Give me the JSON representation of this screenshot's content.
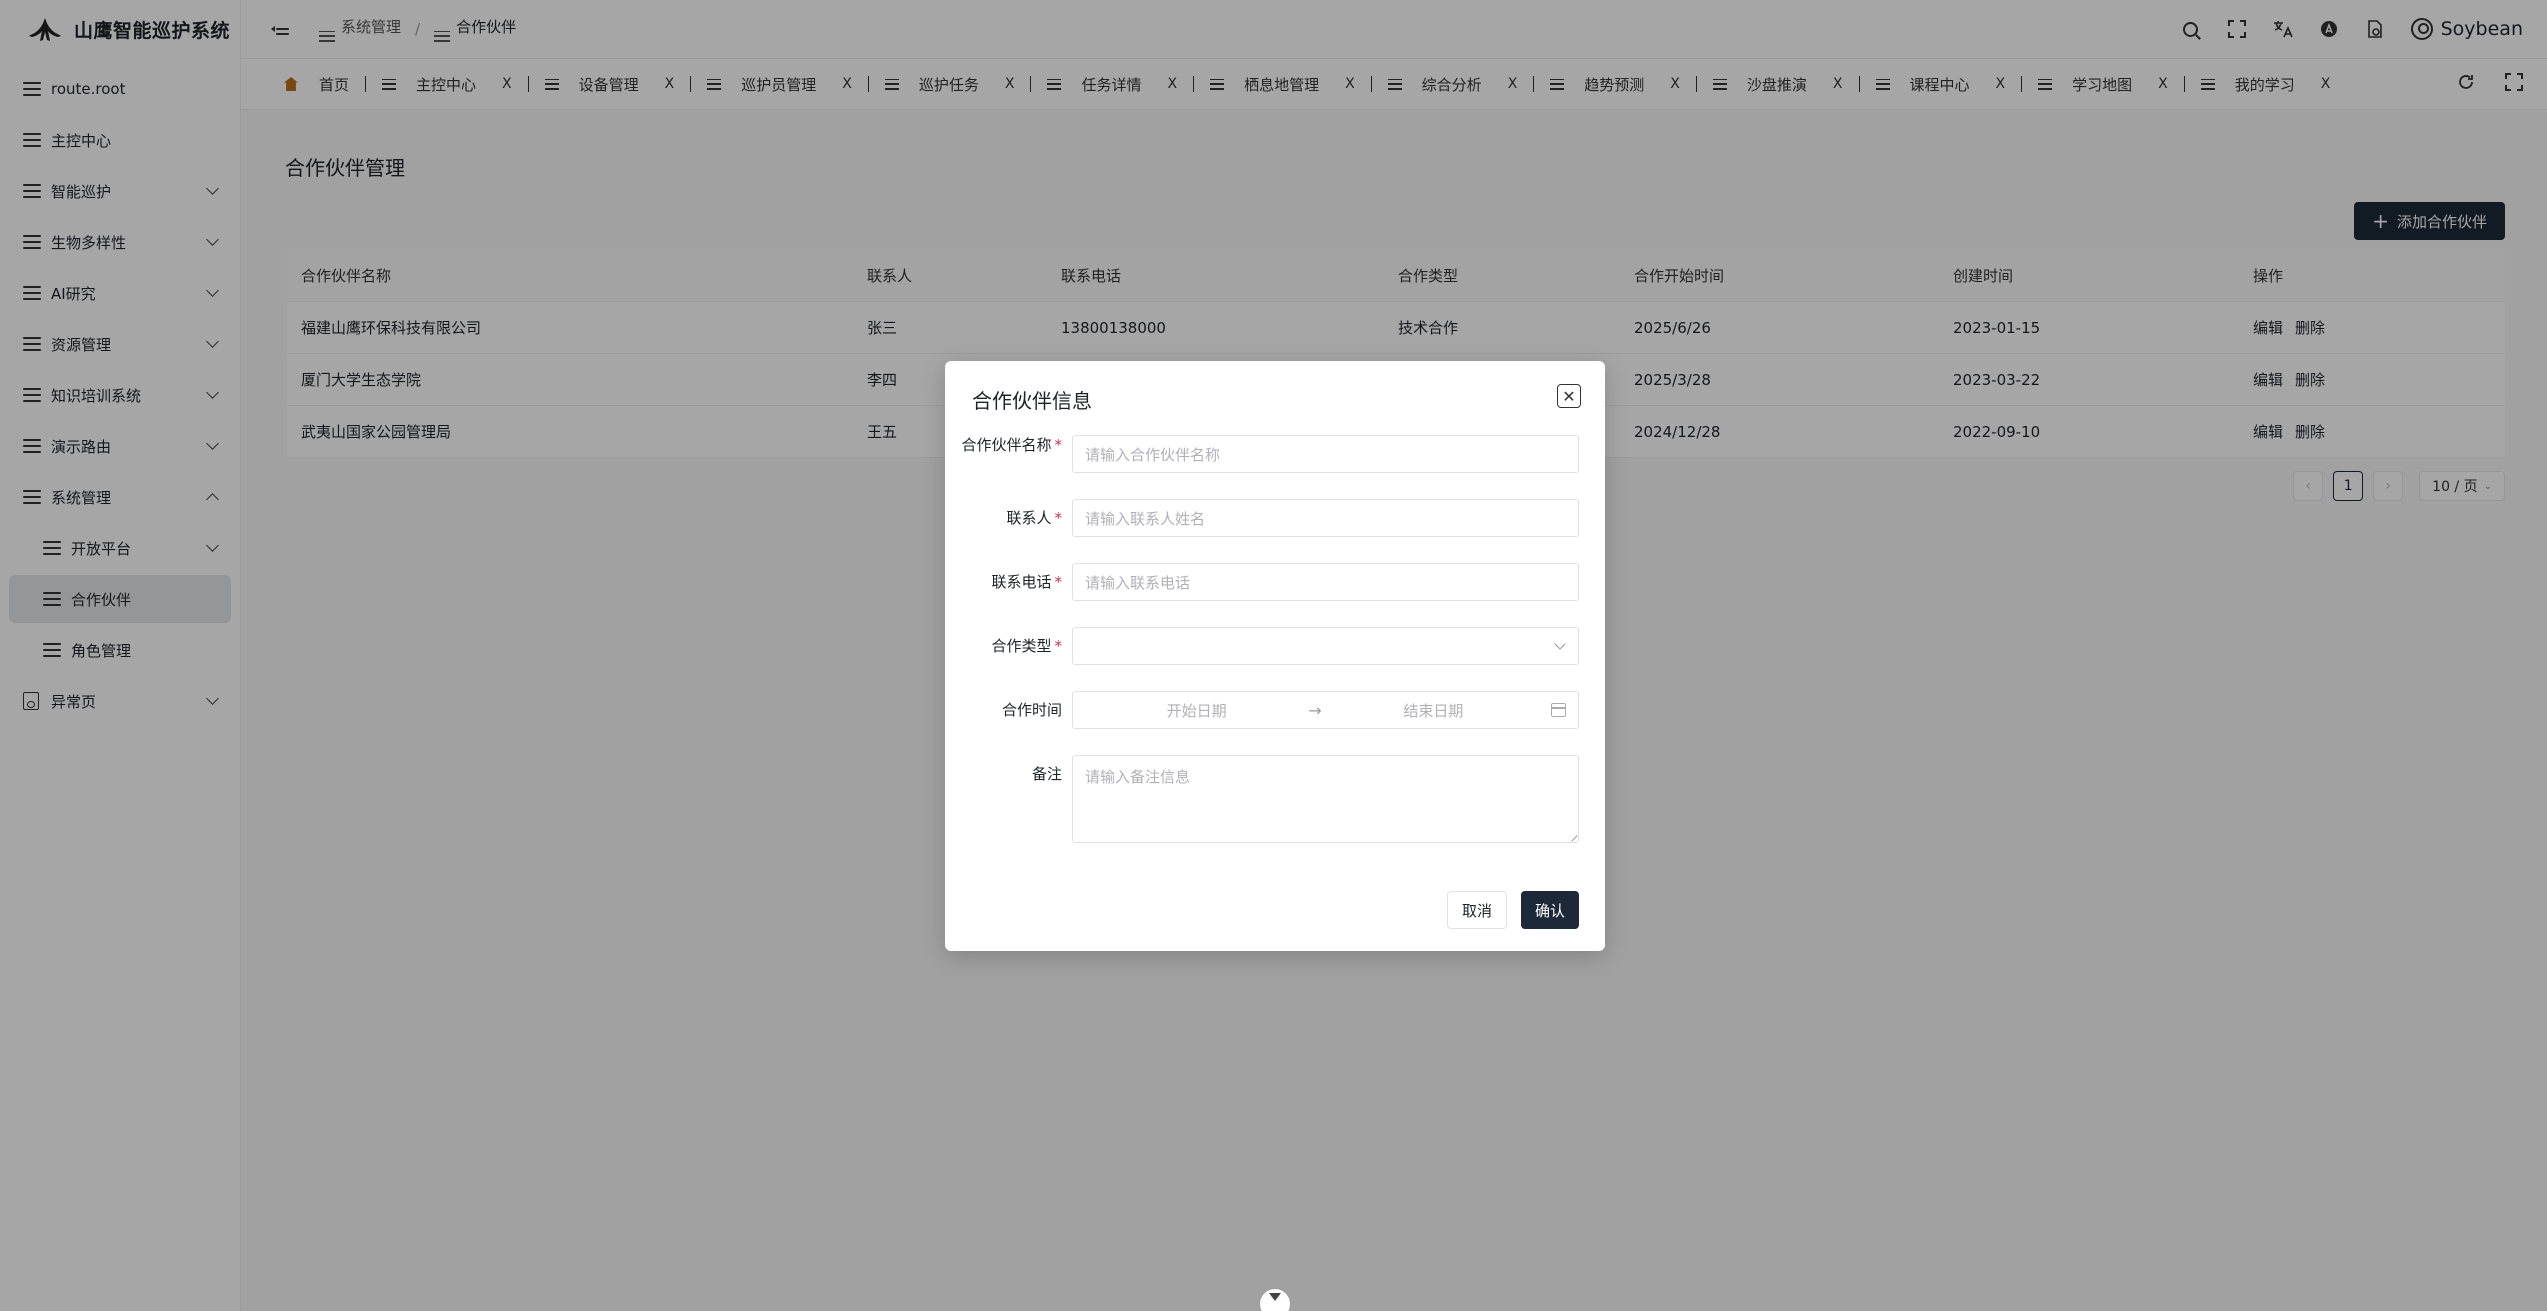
{
  "app": {
    "title": "山鹰智能巡护系统"
  },
  "sidebar": {
    "items": [
      {
        "label": "route.root",
        "chevron": false
      },
      {
        "label": "主控中心",
        "chevron": false
      },
      {
        "label": "智能巡护",
        "chevron": true
      },
      {
        "label": "生物多样性",
        "chevron": true
      },
      {
        "label": "AI研究",
        "chevron": true
      },
      {
        "label": "资源管理",
        "chevron": true
      },
      {
        "label": "知识培训系统",
        "chevron": true
      },
      {
        "label": "演示路由",
        "chevron": true
      },
      {
        "label": "系统管理",
        "chevron": true,
        "expanded": true
      },
      {
        "label": "开放平台",
        "chevron": true,
        "sub": true
      },
      {
        "label": "合作伙伴",
        "sub": true,
        "active": true
      },
      {
        "label": "角色管理",
        "sub": true
      },
      {
        "label": "异常页",
        "chevron": true
      }
    ]
  },
  "header": {
    "breadcrumb": [
      "系统管理",
      "合作伙伴"
    ],
    "breadcrumb_sep": "/",
    "user": "Soybean"
  },
  "tabs": [
    {
      "label": "首页",
      "home": true
    },
    {
      "label": "主控中心"
    },
    {
      "label": "设备管理"
    },
    {
      "label": "巡护员管理"
    },
    {
      "label": "巡护任务"
    },
    {
      "label": "任务详情"
    },
    {
      "label": "栖息地管理"
    },
    {
      "label": "综合分析"
    },
    {
      "label": "趋势预测"
    },
    {
      "label": "沙盘推演"
    },
    {
      "label": "课程中心"
    },
    {
      "label": "学习地图"
    },
    {
      "label": "我的学习"
    }
  ],
  "tab_close": "X",
  "page": {
    "title": "合作伙伴管理",
    "add_button": "添加合作伙伴"
  },
  "table": {
    "columns": [
      "合作伙伴名称",
      "联系人",
      "联系电话",
      "合作类型",
      "合作开始时间",
      "创建时间",
      "操作"
    ],
    "rows": [
      [
        "福建山鹰环保科技有限公司",
        "张三",
        "13800138000",
        "技术合作",
        "2025/6/26",
        "2023-01-15"
      ],
      [
        "厦门大学生态学院",
        "李四",
        "",
        "",
        "2025/3/28",
        "2023-03-22"
      ],
      [
        "武夷山国家公园管理局",
        "王五",
        "",
        "",
        "2024/12/28",
        "2022-09-10"
      ]
    ],
    "edit": "编辑",
    "delete": "删除"
  },
  "pagination": {
    "current": "1",
    "page_size": "10 / 页"
  },
  "modal": {
    "title": "合作伙伴信息",
    "fields": {
      "name_label": "合作伙伴名称",
      "name_placeholder": "请输入合作伙伴名称",
      "contact_label": "联系人",
      "contact_placeholder": "请输入联系人姓名",
      "phone_label": "联系电话",
      "phone_placeholder": "请输入联系电话",
      "type_label": "合作类型",
      "time_label": "合作时间",
      "start_placeholder": "开始日期",
      "end_placeholder": "结束日期",
      "remark_label": "备注",
      "remark_placeholder": "请输入备注信息"
    },
    "required_mark": "*",
    "cancel": "取消",
    "confirm": "确认"
  }
}
